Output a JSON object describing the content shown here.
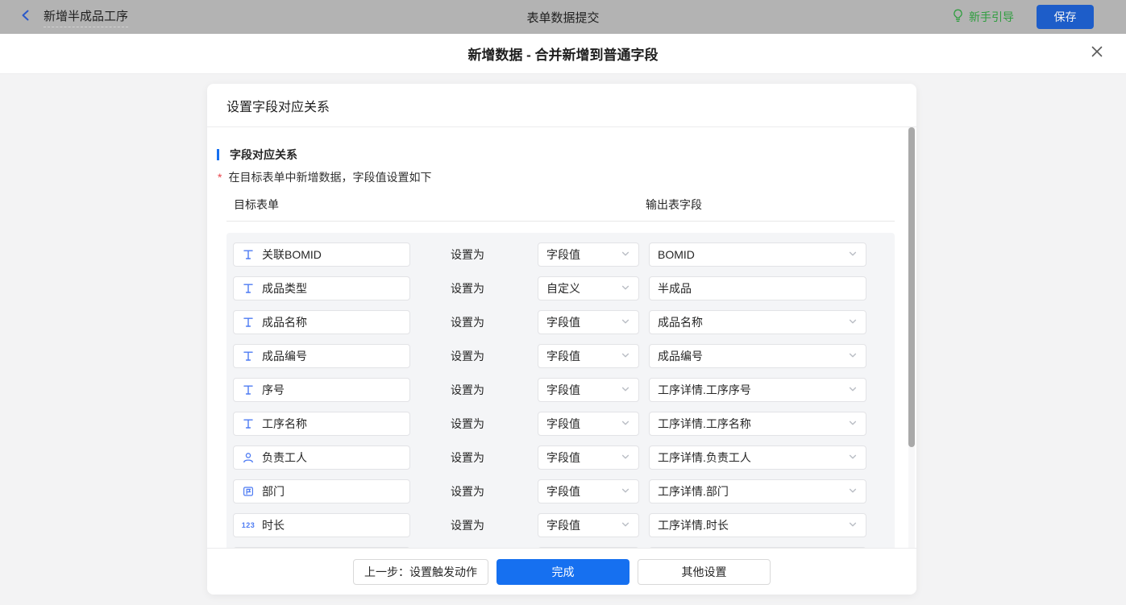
{
  "topbar": {
    "back_label": "新增半成品工序",
    "title": "表单数据提交",
    "guide_label": "新手引导",
    "save_label": "保存"
  },
  "modal": {
    "title": "新增数据 - 合并新增到普通字段",
    "close_icon": "close-x"
  },
  "card": {
    "header": "设置字段对应关系",
    "section_title": "字段对应关系",
    "required_mark": "*",
    "description": "在目标表单中新增数据，字段值设置如下",
    "columns": {
      "target": "目标表单",
      "output": "输出表字段"
    },
    "middle_label": "设置为",
    "rows": [
      {
        "icon": "text",
        "field": "关联BOMID",
        "mode": "字段值",
        "mode_select": true,
        "output": "BOMID",
        "output_select": true,
        "partial": false
      },
      {
        "icon": "text",
        "field": "成品类型",
        "mode": "自定义",
        "mode_select": true,
        "output": "半成品",
        "output_select": false,
        "partial": false
      },
      {
        "icon": "text",
        "field": "成品名称",
        "mode": "字段值",
        "mode_select": true,
        "output": "成品名称",
        "output_select": true,
        "partial": false
      },
      {
        "icon": "text",
        "field": "成品编号",
        "mode": "字段值",
        "mode_select": true,
        "output": "成品编号",
        "output_select": true,
        "partial": false
      },
      {
        "icon": "text",
        "field": "序号",
        "mode": "字段值",
        "mode_select": true,
        "output": "工序详情.工序序号",
        "output_select": true,
        "partial": false
      },
      {
        "icon": "text",
        "field": "工序名称",
        "mode": "字段值",
        "mode_select": true,
        "output": "工序详情.工序名称",
        "output_select": true,
        "partial": false
      },
      {
        "icon": "user",
        "field": "负责工人",
        "mode": "字段值",
        "mode_select": true,
        "output": "工序详情.负责工人",
        "output_select": true,
        "partial": false
      },
      {
        "icon": "dept",
        "field": "部门",
        "mode": "字段值",
        "mode_select": true,
        "output": "工序详情.部门",
        "output_select": true,
        "partial": false
      },
      {
        "icon": "number",
        "field": "时长",
        "mode": "字段值",
        "mode_select": true,
        "output": "工序详情.时长",
        "output_select": true,
        "partial": false
      },
      {
        "icon": "",
        "field": "",
        "mode": "",
        "mode_select": false,
        "output": "",
        "output_select": false,
        "partial": true
      }
    ],
    "number_icon_text": "123"
  },
  "footer": {
    "back_button": "上一步：设置触发动作",
    "finish_button": "完成",
    "other_button": "其他设置"
  },
  "colors": {
    "primary_blue": "#1670f0",
    "save_blue": "#1d5dc9",
    "guide_green": "#2f9e3f",
    "field_icon_blue": "#4d7bf3",
    "required_red": "#e8434a",
    "topbar_dimmed": "#b3b3b3"
  }
}
